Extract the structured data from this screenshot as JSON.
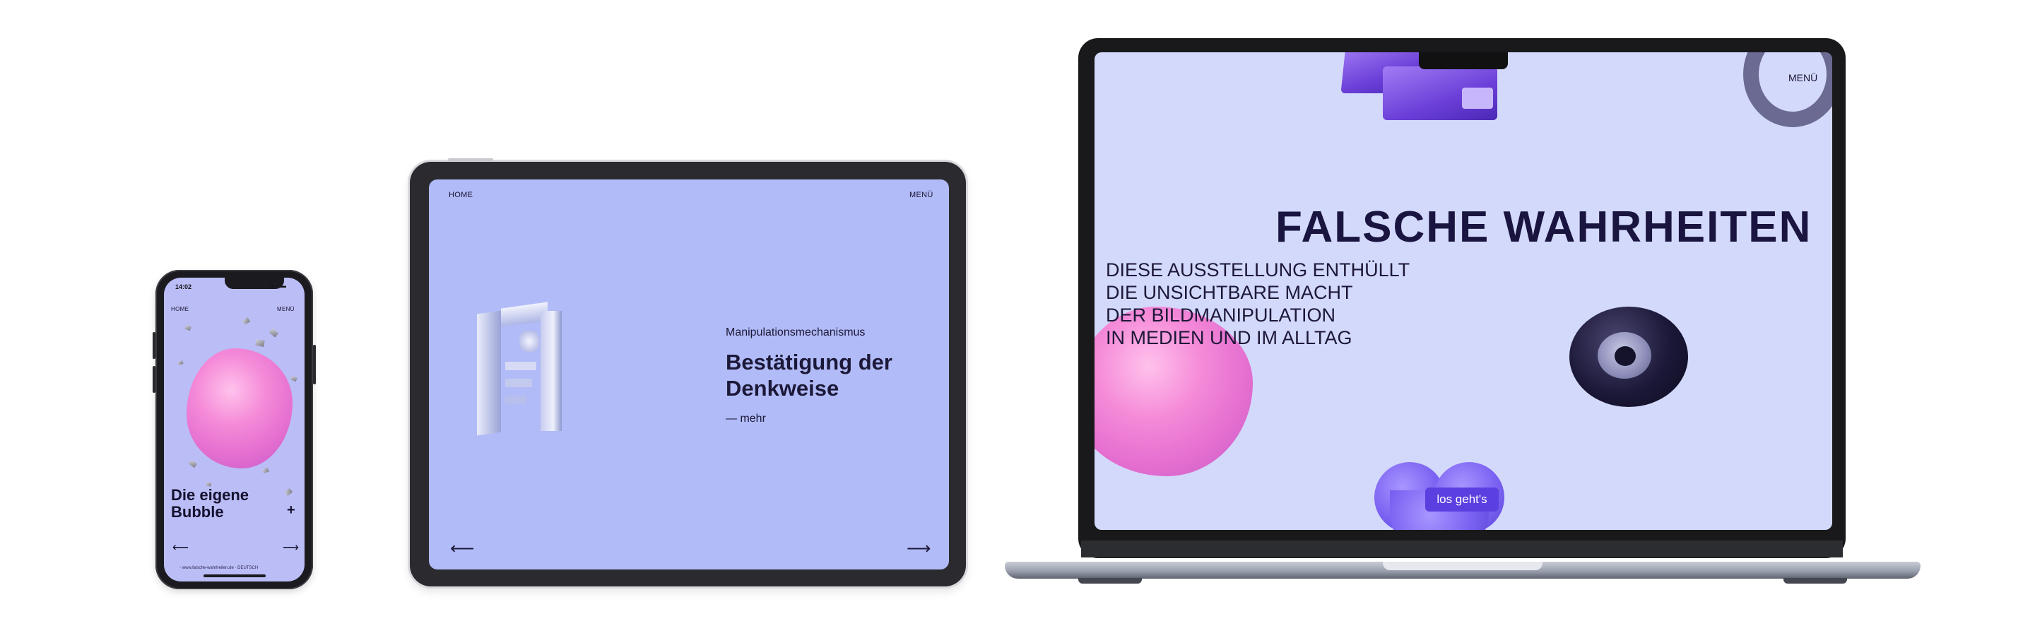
{
  "phone": {
    "status_time": "14:02",
    "status_icons": "▪▪ ◔ ▬",
    "nav_home": "HOME",
    "nav_menu": "MENÜ",
    "title_line1": "Die eigene",
    "title_line2": "Bubble",
    "plus": "+",
    "arrow_prev": "⟵",
    "arrow_next": "⟶",
    "footer": "◦ www.falsche-wahrheiten.de · DEUTSCH"
  },
  "tablet": {
    "nav_home": "HOME",
    "nav_menu": "MENÜ",
    "kicker": "Manipulationsmechanismus",
    "title_line1": "Bestätigung der",
    "title_line2": "Denkweise",
    "more": "— mehr",
    "arrow_prev": "⟵",
    "arrow_next": "⟶"
  },
  "laptop": {
    "menu": "MENÜ",
    "title": "FALSCHE WAHRHEITEN",
    "subtitle_lines": [
      "DIESE AUSSTELLUNG ENTHÜLLT",
      "DIE UNSICHTBARE MACHT",
      "DER BILDMANIPULATION",
      "IN MEDIEN UND IM ALLTAG"
    ],
    "cta": "los geht's"
  },
  "icons": {
    "phone_prev": "arrow-left-icon",
    "phone_next": "arrow-right-icon",
    "tablet_prev": "arrow-left-icon",
    "tablet_next": "arrow-right-icon",
    "phone_plus": "plus-icon"
  },
  "colors": {
    "phone_bg": "#bbbdf6",
    "tablet_bg": "#b1bbf7",
    "laptop_bg": "#d3d9fb",
    "text_dark": "#1a1440",
    "cta": "#5b3fe0"
  }
}
